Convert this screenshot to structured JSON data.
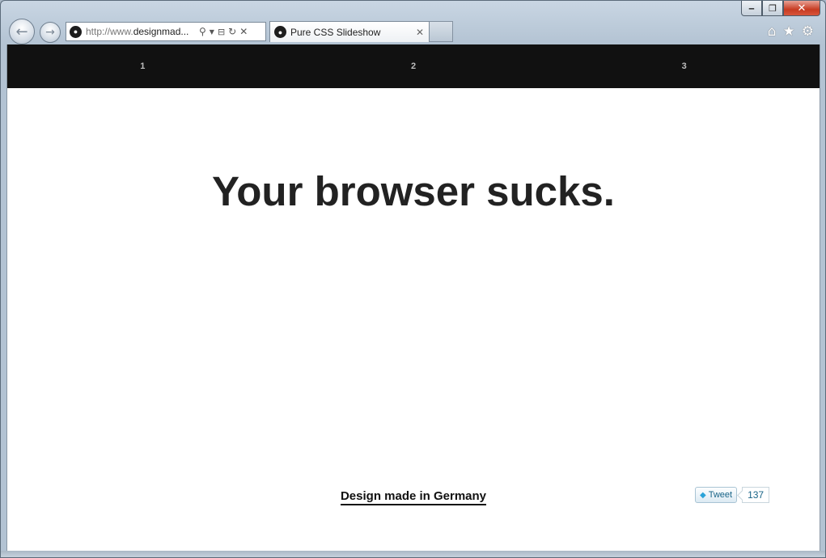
{
  "browser": {
    "address": {
      "url_prefix": "http://www.",
      "url_domain": "designmad...",
      "search_icon": "search-icon",
      "compat_icon": "compatibility-icon",
      "refresh_icon": "refresh-icon",
      "stop_icon": "stop-icon"
    },
    "tab": {
      "title": "Pure CSS Slideshow",
      "close_glyph": "✕"
    },
    "tools": [
      "home-icon",
      "favorites-star-icon",
      "settings-gear-icon"
    ],
    "caption": {
      "minimize": "‒",
      "restore": "❐",
      "close": "✕"
    }
  },
  "page": {
    "slide_nav": [
      {
        "label": "1"
      },
      {
        "label": "2"
      },
      {
        "label": "3"
      }
    ],
    "headline": "Your browser sucks.",
    "footer_link": "Design made in Germany",
    "tweet": {
      "label": "Tweet",
      "count": "137"
    }
  },
  "colors": {
    "nav_background": "#111111",
    "headline": "#222222",
    "tweet_text": "#186487"
  }
}
